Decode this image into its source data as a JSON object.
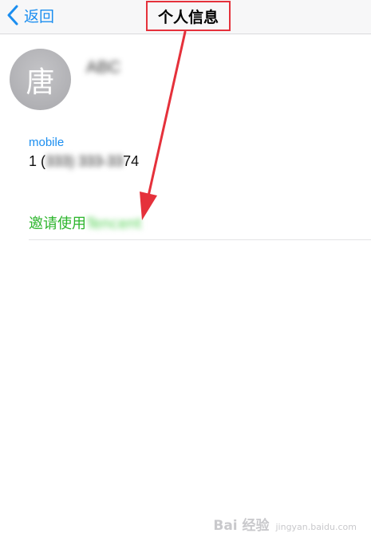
{
  "nav": {
    "back_label": "返回",
    "title": "个人信息"
  },
  "contact": {
    "avatar_char": "唐",
    "name": "ABC",
    "field_label": "mobile",
    "phone_prefix": "1 (",
    "phone_masked": "333) 333-33",
    "phone_suffix": "74"
  },
  "actions": {
    "invite_prefix": "邀请使用",
    "invite_app": "Tencent"
  },
  "watermark": {
    "brand": "Bai 经验",
    "site": "jingyan.baidu.com"
  },
  "colors": {
    "accent": "#1b8ef0",
    "invite": "#2cb52c",
    "highlight": "#e5313b"
  }
}
